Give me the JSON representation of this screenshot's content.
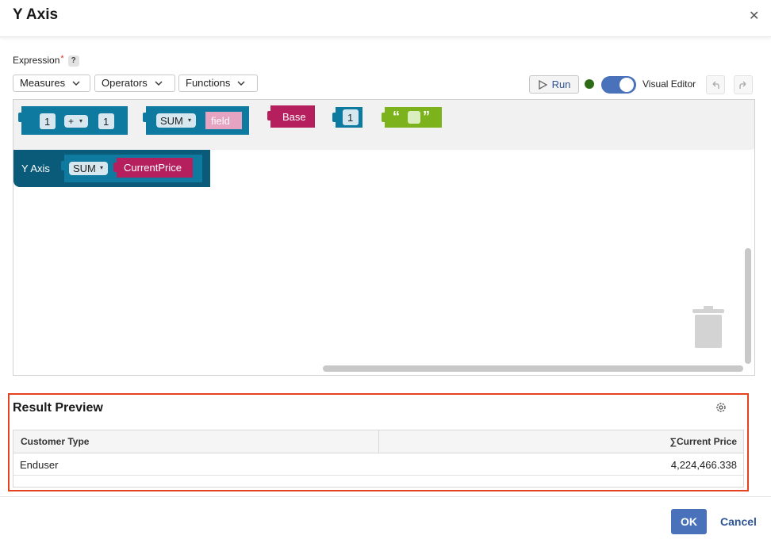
{
  "dialog": {
    "title": "Y Axis"
  },
  "expression": {
    "label": "Expression",
    "required_mark": "*",
    "help_label": "?"
  },
  "toolbar": {
    "measures_label": "Measures",
    "operators_label": "Operators",
    "functions_label": "Functions",
    "run_label": "Run",
    "visual_editor_label": "Visual Editor",
    "visual_editor_on": true
  },
  "flyout": {
    "add_block": {
      "left": "1",
      "op": "+",
      "right": "1"
    },
    "sum_block": {
      "func": "SUM",
      "field": "field"
    },
    "base_block": {
      "label": "Base"
    },
    "number_block": {
      "value": "1"
    },
    "string_block": {
      "open_quote": "“",
      "close_quote": "”"
    }
  },
  "canvas": {
    "root_block": {
      "label": "Y Axis",
      "func": "SUM",
      "field": "CurrentPrice"
    }
  },
  "preview": {
    "title": "Result Preview",
    "columns": [
      "Customer Type",
      "∑Current Price"
    ],
    "rows": [
      [
        "Enduser",
        "4,224,466.338"
      ]
    ]
  },
  "footer": {
    "ok_label": "OK",
    "cancel_label": "Cancel"
  },
  "colors": {
    "accent": "#4a72bb",
    "block_teal": "#0e7aa0",
    "block_magenta": "#b51f5e",
    "block_green": "#7cb21b",
    "highlight": "#e5431f"
  }
}
